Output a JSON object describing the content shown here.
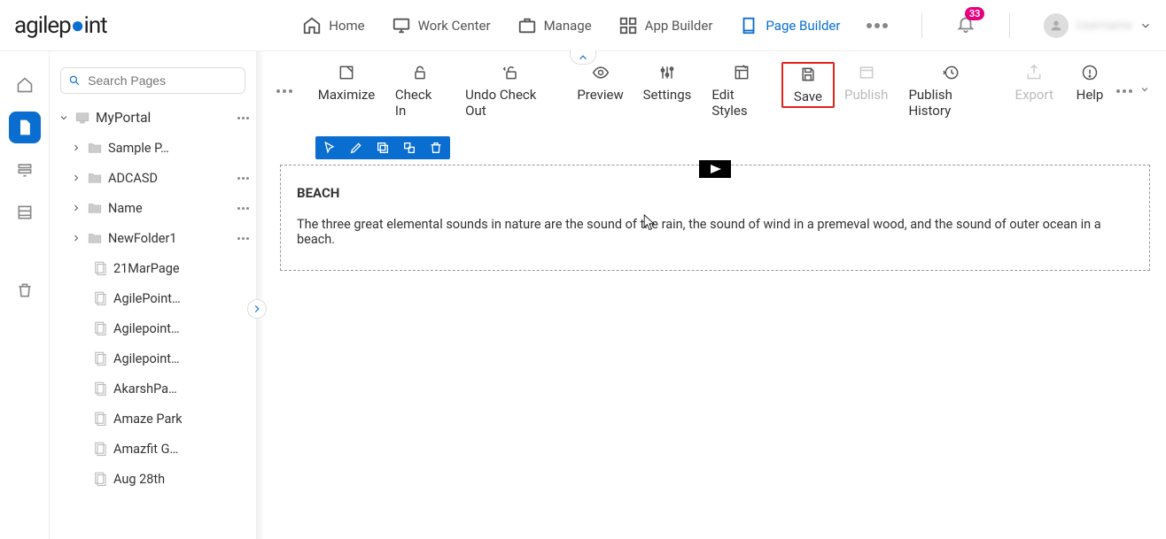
{
  "nav": {
    "home": "Home",
    "work_center": "Work Center",
    "manage": "Manage",
    "app_builder": "App Builder",
    "page_builder": "Page Builder",
    "notification_count": "33"
  },
  "search": {
    "placeholder": "Search Pages"
  },
  "tree": {
    "root": "MyPortal",
    "folders": [
      {
        "label": "Sample P…",
        "dots": false
      },
      {
        "label": "ADCASD",
        "dots": true
      },
      {
        "label": "Name",
        "dots": true
      },
      {
        "label": "NewFolder1",
        "dots": true
      }
    ],
    "pages": [
      "21MarPage",
      "AgilePoint…",
      "Agilepoint…",
      "Agilepoint…",
      "AkarshPa…",
      "Amaze Park",
      "Amazfit G…",
      "Aug 28th"
    ]
  },
  "actions": {
    "maximize": "Maximize",
    "check_in": "Check In",
    "undo_check_out": "Undo Check Out",
    "preview": "Preview",
    "settings": "Settings",
    "edit_styles": "Edit Styles",
    "save": "Save",
    "publish": "Publish",
    "publish_history": "Publish History",
    "export": "Export",
    "help": "Help"
  },
  "content": {
    "title": "BEACH",
    "body": "The three great elemental sounds in nature are the sound of the rain, the sound of wind in a premeval wood, and the sound of outer ocean in a beach."
  }
}
